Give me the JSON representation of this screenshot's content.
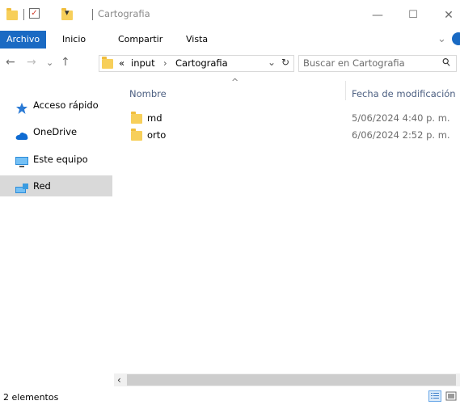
{
  "window": {
    "title": "Cartografia",
    "minimize_glyph": "—",
    "maximize_glyph": "☐",
    "close_glyph": "✕",
    "qat_dropdown_glyph": "▾"
  },
  "ribbon": {
    "tabs": [
      {
        "label": "Archivo",
        "active": true
      },
      {
        "label": "Inicio"
      },
      {
        "label": "Compartir"
      },
      {
        "label": "Vista"
      }
    ],
    "expand_glyph": "⌄"
  },
  "address": {
    "back_glyph": "←",
    "forward_glyph": "→",
    "recent_glyph": "⌄",
    "up_glyph": "↑",
    "overflow": "«",
    "crumbs": [
      "input",
      "Cartografia"
    ],
    "crumb_sep": "›",
    "dropdown_glyph": "⌄",
    "refresh_glyph": "↻"
  },
  "search": {
    "placeholder": "Buscar en Cartografia",
    "icon_glyph": "⚲"
  },
  "nav": {
    "items": [
      {
        "label": "Acceso rápido",
        "icon": "star-icon"
      },
      {
        "label": "OneDrive",
        "icon": "cloud-icon"
      },
      {
        "label": "Este equipo",
        "icon": "computer-icon"
      },
      {
        "label": "Red",
        "icon": "network-icon",
        "selected": true
      }
    ]
  },
  "columns": {
    "name": "Nombre",
    "date": "Fecha de modificación",
    "sort_glyph": "^"
  },
  "files": [
    {
      "name": "md",
      "date": "5/06/2024 4:40 p. m."
    },
    {
      "name": "orto",
      "date": "6/06/2024 2:52 p. m."
    }
  ],
  "scroll": {
    "left_glyph": "‹"
  },
  "status": {
    "count": "2 elementos"
  },
  "colors": {
    "accent": "#1a6ac3",
    "folder": "#f7cf5a",
    "selected_nav": "#d9d9d9",
    "header_text": "#4d6082"
  }
}
